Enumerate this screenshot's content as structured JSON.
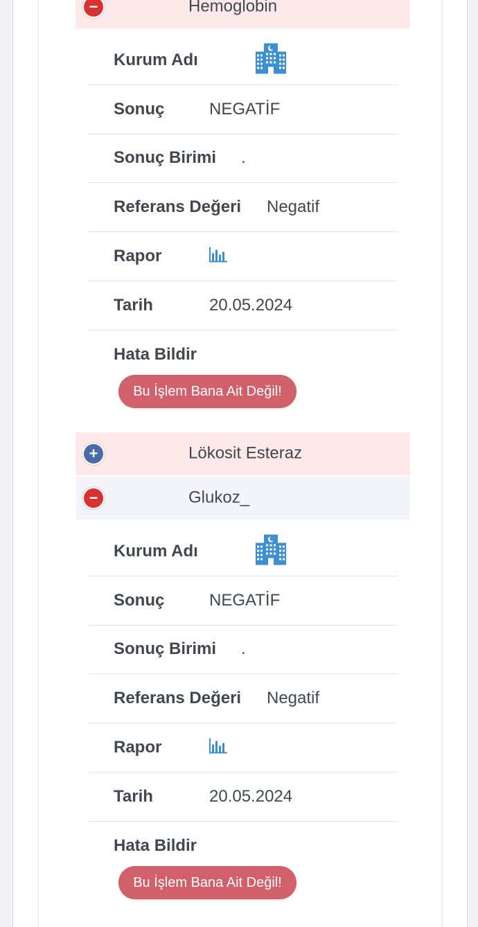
{
  "tests": [
    {
      "title": "Hemoglobin",
      "expanded": true,
      "toggle_symbol": "−",
      "header_color": "#fde8ea",
      "fields": {
        "kurum_label": "Kurum Adı",
        "kurum_icon": "hospital-building-icon",
        "sonuc_label": "Sonuç",
        "sonuc_value": "NEGATİF",
        "birim_label": "Sonuç Birimi",
        "birim_value": ".",
        "referans_label": "Referans Değeri",
        "referans_value": "Negatif",
        "rapor_label": "Rapor",
        "rapor_icon": "bar-chart-icon",
        "tarih_label": "Tarih",
        "tarih_value": "20.05.2024",
        "hata_label": "Hata Bildir",
        "hata_button": "Bu İşlem Bana Ait Değil!"
      }
    },
    {
      "title": "Lökosit Esteraz",
      "expanded": false,
      "toggle_symbol": "+",
      "header_color": "#fde8ea"
    },
    {
      "title": "Glukoz_",
      "expanded": true,
      "toggle_symbol": "−",
      "header_color": "#f4f5fa",
      "fields": {
        "kurum_label": "Kurum Adı",
        "kurum_icon": "hospital-building-icon",
        "sonuc_label": "Sonuç",
        "sonuc_value": "NEGATİF",
        "birim_label": "Sonuç Birimi",
        "birim_value": ".",
        "referans_label": "Referans Değeri",
        "referans_value": "Negatif",
        "rapor_label": "Rapor",
        "rapor_icon": "bar-chart-icon",
        "tarih_label": "Tarih",
        "tarih_value": "20.05.2024",
        "hata_label": "Hata Bildir",
        "hata_button": "Bu İşlem Bana Ait Değil!"
      }
    }
  ],
  "colors": {
    "minus_toggle": "#d63232",
    "plus_toggle": "#4a69a8",
    "error_button": "#d1606a",
    "icon_blue": "#3e8fd0"
  }
}
